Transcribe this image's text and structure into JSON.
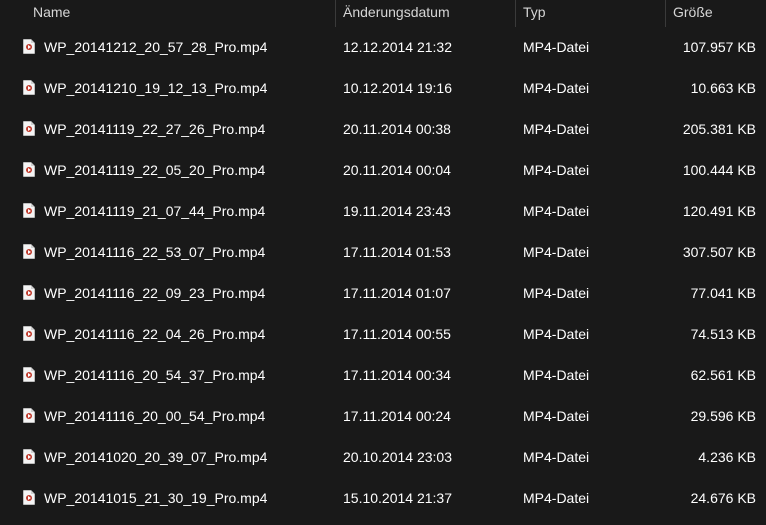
{
  "columns": {
    "name": "Name",
    "date": "Änderungsdatum",
    "type": "Typ",
    "size": "Größe"
  },
  "files": [
    {
      "name": "WP_20141212_20_57_28_Pro.mp4",
      "date": "12.12.2014 21:32",
      "type": "MP4-Datei",
      "size": "107.957 KB",
      "icon": "video-file-icon"
    },
    {
      "name": "WP_20141210_19_12_13_Pro.mp4",
      "date": "10.12.2014 19:16",
      "type": "MP4-Datei",
      "size": "10.663 KB",
      "icon": "video-file-icon"
    },
    {
      "name": "WP_20141119_22_27_26_Pro.mp4",
      "date": "20.11.2014 00:38",
      "type": "MP4-Datei",
      "size": "205.381 KB",
      "icon": "video-file-icon"
    },
    {
      "name": "WP_20141119_22_05_20_Pro.mp4",
      "date": "20.11.2014 00:04",
      "type": "MP4-Datei",
      "size": "100.444 KB",
      "icon": "video-file-icon"
    },
    {
      "name": "WP_20141119_21_07_44_Pro.mp4",
      "date": "19.11.2014 23:43",
      "type": "MP4-Datei",
      "size": "120.491 KB",
      "icon": "video-file-icon"
    },
    {
      "name": "WP_20141116_22_53_07_Pro.mp4",
      "date": "17.11.2014 01:53",
      "type": "MP4-Datei",
      "size": "307.507 KB",
      "icon": "video-file-icon"
    },
    {
      "name": "WP_20141116_22_09_23_Pro.mp4",
      "date": "17.11.2014 01:07",
      "type": "MP4-Datei",
      "size": "77.041 KB",
      "icon": "video-file-icon"
    },
    {
      "name": "WP_20141116_22_04_26_Pro.mp4",
      "date": "17.11.2014 00:55",
      "type": "MP4-Datei",
      "size": "74.513 KB",
      "icon": "video-file-icon"
    },
    {
      "name": "WP_20141116_20_54_37_Pro.mp4",
      "date": "17.11.2014 00:34",
      "type": "MP4-Datei",
      "size": "62.561 KB",
      "icon": "video-file-icon"
    },
    {
      "name": "WP_20141116_20_00_54_Pro.mp4",
      "date": "17.11.2014 00:24",
      "type": "MP4-Datei",
      "size": "29.596 KB",
      "icon": "video-file-icon"
    },
    {
      "name": "WP_20141020_20_39_07_Pro.mp4",
      "date": "20.10.2014 23:03",
      "type": "MP4-Datei",
      "size": "4.236 KB",
      "icon": "video-file-icon"
    },
    {
      "name": "WP_20141015_21_30_19_Pro.mp4",
      "date": "15.10.2014 21:37",
      "type": "MP4-Datei",
      "size": "24.676 KB",
      "icon": "video-file-icon"
    }
  ],
  "colors": {
    "background": "#191919",
    "text": "#ffffff",
    "header_text": "#d6d6d6",
    "separator": "#3a3a3a"
  }
}
